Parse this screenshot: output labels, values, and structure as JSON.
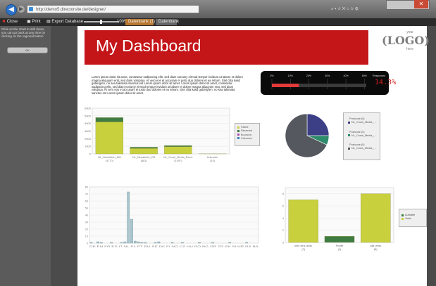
{
  "browser": {
    "address": "http://demo5.directorsite.de/designer/",
    "search_placeholder": "",
    "window_buttons": [
      "–",
      "▢",
      "✕"
    ]
  },
  "toolbar": {
    "close_label": "Close",
    "print_label": "Print",
    "export_label": "Export Database",
    "zoom_label": "100%",
    "tab1_label": "Datenbank (1)",
    "tab2_label": "Datenbank"
  },
  "sidebar": {
    "help_text": "Click on the chart to drill down, you can go back at any time by clicking on the regional button",
    "button_label": "OK"
  },
  "header": {
    "title": "My Dashboard",
    "logo_top": "your",
    "logo_main": "LOGO",
    "logo_bottom": "here"
  },
  "intro_text": "Lorem ipsum dolor sit amet, consetetur sadipscing elitr, sed diam nonumy eirmod tempor invidunt ut labore et dolore magna aliquyam erat, sed diam voluptua. At vero eos et accusam et justo duo dolores et ea rebum. Stet clita kasd gubergren, no sea takimata sanctus est Lorem ipsum dolor sit amet. Lorem ipsum dolor sit amet, consetetur sadipscing elitr, sed diam nonumy eirmod tempor invidunt ut labore et dolore magna aliquyam erat, sed diam voluptua. At vero eos et accusam et justo duo dolores et ea rebum. Stet clita kasd gubergren, no sea takimata sanctus est Lorem ipsum dolor sit amet.",
  "gauge": {
    "ticks": [
      "0%",
      "10%",
      "20%",
      "30%",
      "40%",
      "50%"
    ],
    "label": "Responses",
    "value_text": "14.3%",
    "value": 0.143
  },
  "colors": {
    "banner": "#c41519",
    "olive": "#b9bf3e",
    "green": "#3e7c42",
    "navy": "#3c3f86",
    "teal": "#2d8a6a",
    "grey": "#55585f"
  },
  "chart_data": [
    {
      "type": "bar",
      "stacked": true,
      "categories": [
        "NL_Newsletter_BM",
        "NL_Newsletter_DB",
        "NL_Cross_Media_Event",
        "Unknown"
      ],
      "category_counts": [
        "(4770)",
        "(881)",
        "(1097)",
        "(10)"
      ],
      "series": [
        {
          "name": "Failed",
          "color": "#c9d03e",
          "values": [
            4200,
            720,
            950,
            0
          ]
        },
        {
          "name": "Reserved",
          "color": "#3e7c42",
          "values": [
            570,
            161,
            147,
            10
          ]
        },
        {
          "name": "Bounced",
          "color": "#a64ea2",
          "values": [
            0,
            0,
            0,
            0
          ]
        },
        {
          "name": "Unknown",
          "color": "#3c7fc1",
          "values": [
            0,
            0,
            0,
            0
          ]
        }
      ],
      "y_ticks": [
        "6000",
        "5000",
        "4000",
        "3000",
        "2000",
        "1000",
        "0"
      ],
      "ylim": [
        0,
        6000
      ]
    },
    {
      "type": "pie",
      "slices": [
        {
          "label": "Postcode (0)",
          "value": 25,
          "color": "#3c3f86"
        },
        {
          "label": "NL_Cross_Media_...",
          "value": 7,
          "color": "#2d8a6a"
        },
        {
          "label": "Postcode (0)",
          "value": 68,
          "color": "#55585f"
        }
      ],
      "legend": [
        "Postcode (0)",
        "NL_Cross_Media_...",
        "Postcode (0)",
        "NL_Cross_Media_...",
        "Postcode (0)",
        "NL_Cross_Media_..."
      ]
    },
    {
      "type": "bar",
      "y_ticks": [
        "80",
        "70",
        "60",
        "50",
        "40",
        "30",
        "20",
        "10",
        "0"
      ],
      "ylim": [
        0,
        80
      ],
      "values": [
        1,
        0,
        2,
        1,
        0,
        0,
        1,
        0,
        0,
        1,
        2,
        73,
        34,
        3,
        2,
        1,
        1,
        0,
        0,
        1,
        2,
        0,
        0,
        0,
        1,
        0,
        0,
        1,
        0,
        0,
        0,
        0,
        1,
        0,
        0,
        0,
        1,
        0,
        0,
        0,
        0,
        1,
        0,
        0,
        0,
        0,
        1,
        0,
        0,
        0
      ],
      "x_tick_labels": "DE EN FR ES IT NL PL PT RU SE DK FI NO CZ HU RO BG GR TR SK SI HR RS BA"
    },
    {
      "type": "bar",
      "categories": [
        "kein eins visits",
        "Profile",
        "alle visits"
      ],
      "category_counts": [
        "(7)",
        "(1)",
        "(8)"
      ],
      "series": [
        {
          "name": "Auftraffe",
          "color": "#3e7c42",
          "values": [
            0,
            1,
            0
          ]
        },
        {
          "name": "Visits",
          "color": "#c9d03e",
          "values": [
            7,
            0,
            8
          ]
        }
      ],
      "y_ticks": [
        "8",
        "6",
        "4",
        "2",
        "0"
      ],
      "ylim": [
        0,
        9
      ]
    }
  ]
}
